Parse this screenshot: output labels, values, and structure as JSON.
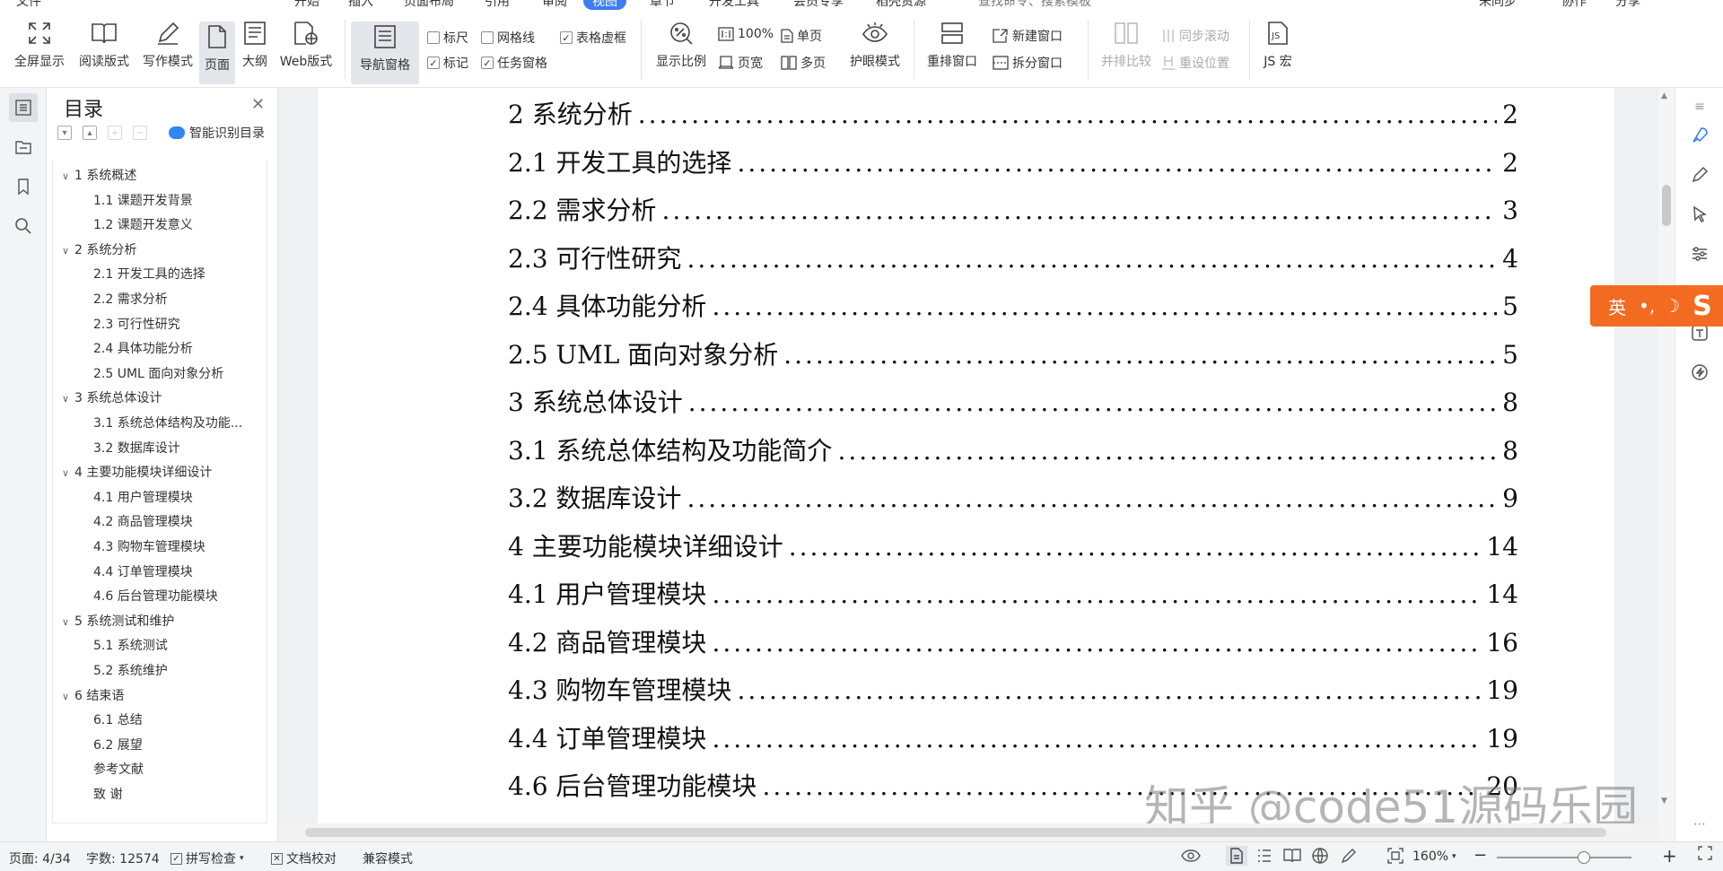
{
  "menubar": {
    "items": [
      "文件",
      "开始",
      "插入",
      "页面布局",
      "引用",
      "审阅",
      "视图",
      "章节",
      "开发工具",
      "会员专享",
      "稻壳资源",
      "查找命令、搜索模板",
      "未同步",
      "协作",
      "分享"
    ]
  },
  "ribbon": {
    "fullscreen": "全屏显示",
    "reading": "阅读版式",
    "writing": "写作模式",
    "page": "页面",
    "outline": "大纲",
    "web": "Web版式",
    "nav_pane": "导航窗格",
    "ruler": "标尺",
    "gridlines": "网格线",
    "table_gridlines": "表格虚框",
    "mark": "标记",
    "task_pane": "任务窗格",
    "show_ratio": "显示比例",
    "zoom_100": "100%",
    "single_page": "单页",
    "page_width": "页宽",
    "multi_page": "多页",
    "eye_mode": "护眼模式",
    "rearrange": "重排窗口",
    "new_window": "新建窗口",
    "split_window": "拆分窗口",
    "side_by_side": "并排比较",
    "sync_scroll": "同步滚动",
    "reset_position": "重设位置",
    "js_macro": "JS 宏"
  },
  "toc_panel": {
    "title": "目录",
    "smart_toc": "智能识别目录",
    "items": [
      {
        "level": 1,
        "text": "1  系统概述"
      },
      {
        "level": 2,
        "text": "1.1  课题开发背景"
      },
      {
        "level": 2,
        "text": "1.2  课题开发意义"
      },
      {
        "level": 1,
        "text": "2  系统分析"
      },
      {
        "level": 2,
        "text": "2.1  开发工具的选择"
      },
      {
        "level": 2,
        "text": "2.2  需求分析"
      },
      {
        "level": 2,
        "text": "2.3  可行性研究"
      },
      {
        "level": 2,
        "text": "2.4  具体功能分析"
      },
      {
        "level": 2,
        "text": "2.5  UML 面向对象分析"
      },
      {
        "level": 1,
        "text": "3  系统总体设计"
      },
      {
        "level": 2,
        "text": "3.1  系统总体结构及功能..."
      },
      {
        "level": 2,
        "text": "3.2  数据库设计"
      },
      {
        "level": 1,
        "text": "4  主要功能模块详细设计"
      },
      {
        "level": 2,
        "text": "4.1  用户管理模块"
      },
      {
        "level": 2,
        "text": "4.2  商品管理模块"
      },
      {
        "level": 2,
        "text": "4.3  购物车管理模块"
      },
      {
        "level": 2,
        "text": "4.4  订单管理模块"
      },
      {
        "level": 2,
        "text": "4.6  后台管理功能模块"
      },
      {
        "level": 1,
        "text": "5  系统测试和维护"
      },
      {
        "level": 2,
        "text": "5.1  系统测试"
      },
      {
        "level": 2,
        "text": "5.2  系统维护"
      },
      {
        "level": 1,
        "text": "6  结束语"
      },
      {
        "level": 2,
        "text": "6.1  总结"
      },
      {
        "level": 2,
        "text": "6.2  展望"
      },
      {
        "level": 3,
        "text": "参考文献"
      },
      {
        "level": 3,
        "text": "致      谢"
      }
    ]
  },
  "document": {
    "toc_lines": [
      {
        "title": "2 系统分析",
        "page": "2"
      },
      {
        "title": "2.1 开发工具的选择",
        "page": "2"
      },
      {
        "title": "2.2 需求分析",
        "page": "3"
      },
      {
        "title": "2.3 可行性研究",
        "page": "4"
      },
      {
        "title": "2.4 具体功能分析",
        "page": "5"
      },
      {
        "title": "2.5 UML 面向对象分析",
        "page": "5"
      },
      {
        "title": "3 系统总体设计",
        "page": "8"
      },
      {
        "title": "3.1 系统总体结构及功能简介",
        "page": "8"
      },
      {
        "title": "3.2 数据库设计",
        "page": "9"
      },
      {
        "title": "4 主要功能模块详细设计",
        "page": "14"
      },
      {
        "title": "4.1 用户管理模块",
        "page": "14"
      },
      {
        "title": "4.2 商品管理模块",
        "page": "16"
      },
      {
        "title": "4.3 购物车管理模块",
        "page": "19"
      },
      {
        "title": "4.4 订单管理模块",
        "page": "19"
      },
      {
        "title": "4.6 后台管理功能模块",
        "page": "20"
      }
    ],
    "watermark": "知乎 @code51源码乐园"
  },
  "ime": {
    "label": "英"
  },
  "status": {
    "page": "页面: 4/34",
    "words": "字数: 12574",
    "spell": "拼写检查",
    "proof": "文档校对",
    "compat": "兼容模式",
    "zoom": "160%"
  }
}
